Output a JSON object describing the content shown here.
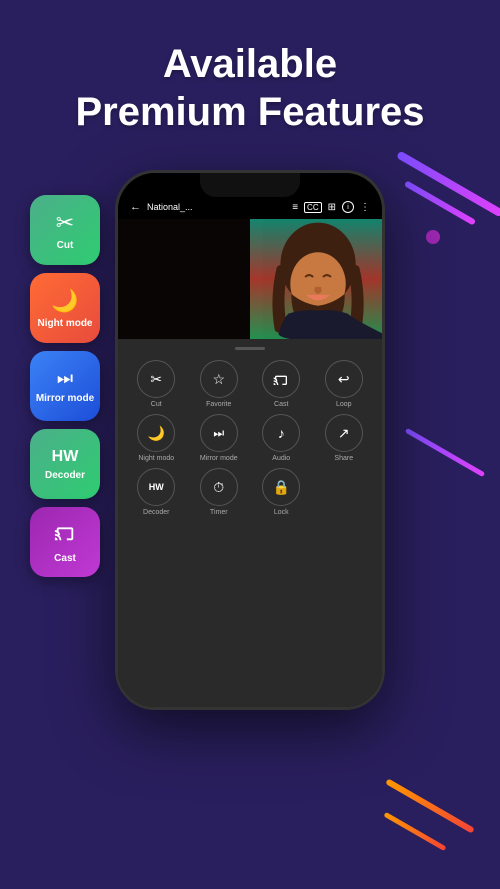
{
  "page": {
    "title_line1": "Available",
    "title_line2": "Premium Features",
    "background_color": "#2a1f5e"
  },
  "phone": {
    "statusbar": {
      "back_label": "←",
      "title": "National_...",
      "icons": [
        "list",
        "cc",
        "sliders",
        "info",
        "more"
      ]
    }
  },
  "feature_buttons": [
    {
      "id": "cut",
      "label": "Cut",
      "icon": "✂",
      "class": "btn-cut"
    },
    {
      "id": "night",
      "label": "Night mode",
      "icon": "🌙",
      "class": "btn-night"
    },
    {
      "id": "mirror",
      "label": "Mirror mode",
      "icon": "⏭",
      "class": "btn-mirror"
    },
    {
      "id": "decoder",
      "label": "Decoder",
      "icon": "HW",
      "class": "btn-decoder"
    },
    {
      "id": "cast",
      "label": "Cast",
      "icon": "📡",
      "class": "btn-cast"
    }
  ],
  "menu_items_row1": [
    {
      "label": "Cut",
      "icon": "✂"
    },
    {
      "label": "Favorite",
      "icon": "☆"
    },
    {
      "label": "Cast",
      "icon": "📡"
    },
    {
      "label": "Loop",
      "icon": "↩"
    }
  ],
  "menu_items_row2": [
    {
      "label": "Night modo",
      "icon": "🌙"
    },
    {
      "label": "Mirror mode",
      "icon": "⏭"
    },
    {
      "label": "Audio",
      "icon": "🎵"
    },
    {
      "label": "Share",
      "icon": "↗"
    }
  ],
  "menu_items_row3": [
    {
      "label": "Decoder",
      "icon": "HW"
    },
    {
      "label": "Timer",
      "icon": "⏱"
    },
    {
      "label": "Lock",
      "icon": "🔒"
    },
    {
      "label": "",
      "icon": ""
    }
  ]
}
